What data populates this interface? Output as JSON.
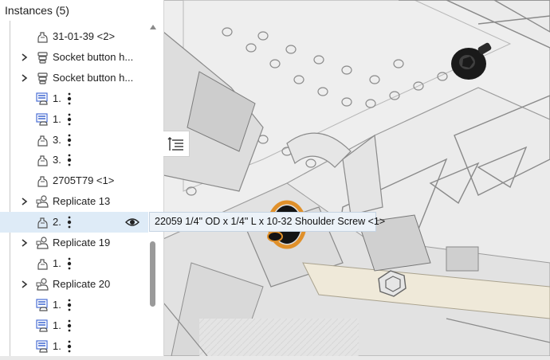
{
  "panel": {
    "title": "Instances (5)",
    "rows": [
      {
        "label": "31-01-39 <2>",
        "icon": "part-instance-icon",
        "expandable": false,
        "selected": false
      },
      {
        "label": "Socket button h...",
        "icon": "subassembly-icon",
        "expandable": true,
        "selected": false
      },
      {
        "label": "Socket button h...",
        "icon": "subassembly-icon",
        "expandable": true,
        "selected": false
      },
      {
        "label": "1.",
        "icon": "standard-content-icon",
        "expandable": false,
        "selected": false
      },
      {
        "label": "1.",
        "icon": "standard-content-icon",
        "expandable": false,
        "selected": false
      },
      {
        "label": "3.",
        "icon": "part-instance-icon",
        "expandable": false,
        "selected": false
      },
      {
        "label": "3.",
        "icon": "part-instance-icon",
        "expandable": false,
        "selected": false
      },
      {
        "label": "2705T79 <1>",
        "icon": "part-instance-icon",
        "expandable": false,
        "selected": false
      },
      {
        "label": "Replicate 13",
        "icon": "replicate-icon",
        "expandable": true,
        "selected": false
      },
      {
        "label": "2.",
        "icon": "part-instance-icon",
        "expandable": false,
        "selected": true
      },
      {
        "label": "Replicate 19",
        "icon": "replicate-icon",
        "expandable": true,
        "selected": false
      },
      {
        "label": "1.",
        "icon": "part-instance-icon",
        "expandable": false,
        "selected": false
      },
      {
        "label": "Replicate 20",
        "icon": "replicate-icon",
        "expandable": true,
        "selected": false
      },
      {
        "label": "1.",
        "icon": "standard-content-icon",
        "expandable": false,
        "selected": false
      },
      {
        "label": "1.",
        "icon": "standard-content-icon",
        "expandable": false,
        "selected": false
      },
      {
        "label": "1.",
        "icon": "standard-content-icon",
        "expandable": false,
        "selected": false
      }
    ]
  },
  "tooltip": {
    "text": "22059 1/4\" OD x 1/4\" L x 10-32 Shoulder Screw <1>"
  },
  "icons": {
    "expand": "chevron-right-icon",
    "visibility": "eye-icon",
    "list_toggle": "list-view-icon",
    "scroll_up": "scroll-up-arrow-icon",
    "more": "vertical-dots-icon"
  },
  "colors": {
    "selected_row": "#deebf7",
    "tooltip_bg": "#ecf2f8",
    "standard_content_icon": "#4a6fd4",
    "highlight_orange": "#e0902a"
  }
}
